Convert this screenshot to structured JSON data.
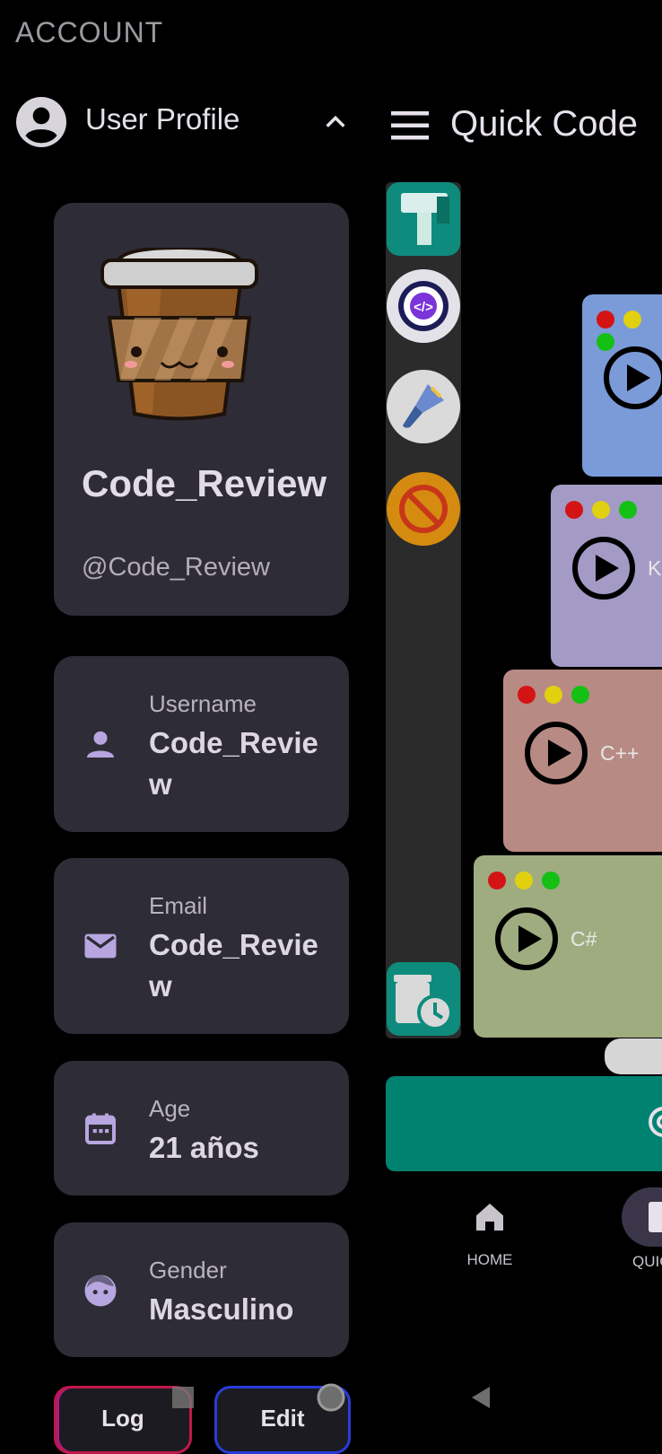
{
  "drawer": {
    "title": "ACCOUNT",
    "profile_label": "User Profile"
  },
  "profile": {
    "display_name": "Code_Review",
    "handle": "@Code_Review"
  },
  "fields": {
    "username": {
      "label": "Username",
      "value": "Code_Review"
    },
    "email": {
      "label": "Email",
      "value": "Code_Review"
    },
    "age": {
      "label": "Age",
      "value": "21 años"
    },
    "gender": {
      "label": "Gender",
      "value": "Masculino"
    }
  },
  "buttons": {
    "logout_label": "Log",
    "edit_label": "Edit"
  },
  "app": {
    "title": "Quick Code",
    "languages": [
      {
        "name": ""
      },
      {
        "name": "Ko"
      },
      {
        "name": "C++"
      },
      {
        "name": "C#"
      }
    ],
    "nav": {
      "home_label": "HOME",
      "quick_label": "QUIC"
    }
  },
  "icons": {
    "profile": "account-circle-icon",
    "chevron": "chevron-up-icon",
    "username": "person-icon",
    "email": "mail-icon",
    "age": "calendar-icon",
    "gender": "face-icon",
    "menu": "hamburger-icon",
    "rail": [
      "hammer-icon",
      "code-gear-icon",
      "brush-icon",
      "block-icon",
      "trash-clock-icon"
    ]
  },
  "colors": {
    "background": "#000000",
    "card": "#2e2c36",
    "accent": "#b7a6e0",
    "teal": "#0e8b7d"
  }
}
